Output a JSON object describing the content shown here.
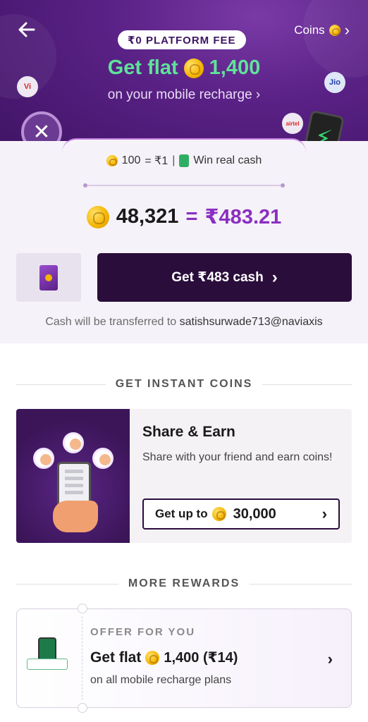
{
  "hero": {
    "fee_pill": "₹0 PLATFORM FEE",
    "title_prefix": "Get flat",
    "title_amount": "1,400",
    "subtitle": "on your mobile recharge",
    "subtitle_chevron": "›",
    "coins_link": "Coins",
    "coins_chevron": "›",
    "operator_logos": [
      "Vi",
      "Jio",
      "airtel"
    ]
  },
  "conversion": {
    "rate_coins": "100",
    "rate_equals": "= ₹1",
    "rate_sep": "|",
    "rate_note": "Win real cash",
    "balance_coins": "48,321",
    "balance_equals": "=",
    "balance_rupees": "₹483.21",
    "cta_label": "Get ₹483 cash",
    "cta_chevron": "›",
    "transfer_prefix": "Cash will be transferred to",
    "transfer_upi": "satishsurwade713@naviaxis"
  },
  "sections": {
    "instant_coins": "GET INSTANT COINS",
    "more_rewards": "MORE REWARDS"
  },
  "share": {
    "title": "Share & Earn",
    "description": "Share with your friend and earn coins!",
    "button_prefix": "Get up to",
    "button_amount": "30,000",
    "button_chevron": "›"
  },
  "offer": {
    "label": "OFFER FOR YOU",
    "title_prefix": "Get flat",
    "title_amount": "1,400 (₹14)",
    "subtitle": "on all mobile recharge plans",
    "chevron": "›"
  },
  "colors": {
    "hero_bg": "#5a2186",
    "hero_title": "#5fe39a",
    "accent_purple": "#8a2fc0",
    "cta_bg": "#2a0d3b",
    "coin_gold": "#f4b400"
  },
  "icons": {
    "back": "arrow-left-icon",
    "coin": "coin-icon",
    "chevron": "chevron-right-icon"
  }
}
